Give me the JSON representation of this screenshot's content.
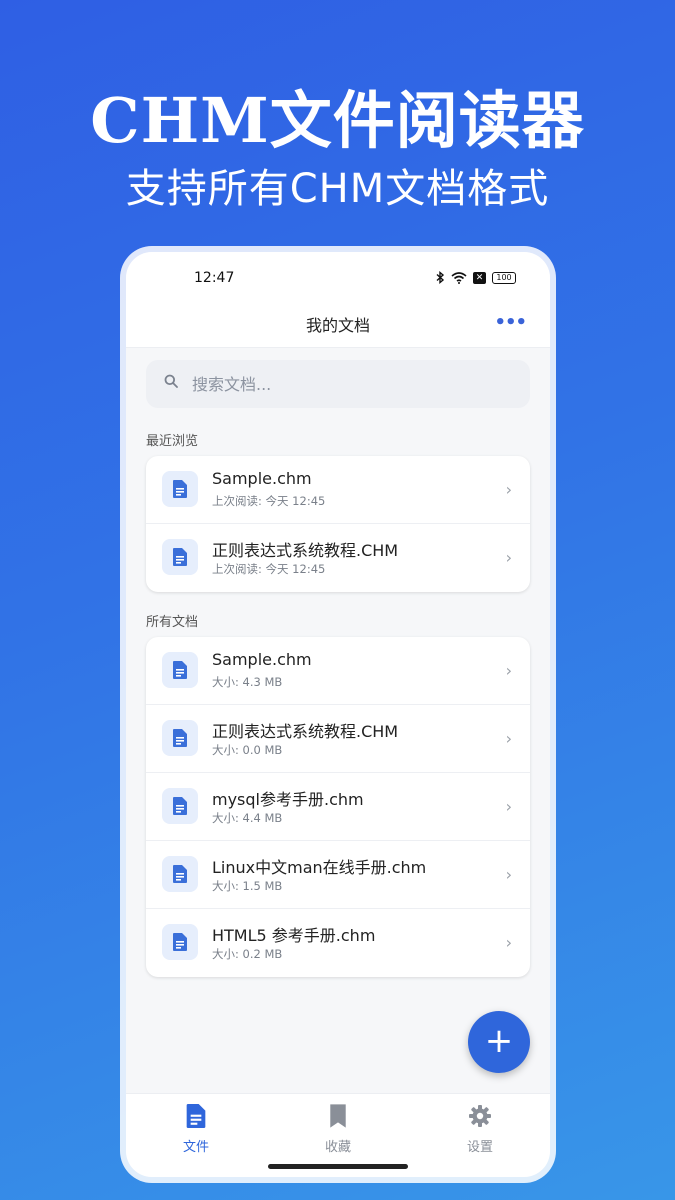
{
  "promo": {
    "title": "CHM文件阅读器",
    "subtitle": "支持所有CHM文档格式"
  },
  "status_bar": {
    "time": "12:47",
    "battery": "100",
    "icons": [
      "bluetooth-icon",
      "wifi-icon",
      "sim-off-icon",
      "battery-icon"
    ]
  },
  "app_bar": {
    "title": "我的文档",
    "more_icon": "more-horizontal-icon"
  },
  "search": {
    "placeholder": "搜索文档..."
  },
  "recent": {
    "label": "最近浏览",
    "items": [
      {
        "name": "Sample.chm",
        "meta": "上次阅读: 今天 12:45"
      },
      {
        "name": "正则表达式系统教程.CHM",
        "meta": "上次阅读: 今天 12:45"
      }
    ]
  },
  "all_docs": {
    "label": "所有文档",
    "items": [
      {
        "name": "Sample.chm",
        "meta": "大小: 4.3 MB"
      },
      {
        "name": "正则表达式系统教程.CHM",
        "meta": "大小: 0.0 MB"
      },
      {
        "name": "mysql参考手册.chm",
        "meta": "大小: 4.4 MB"
      },
      {
        "name": "Linux中文man在线手册.chm",
        "meta": "大小: 1.5 MB"
      },
      {
        "name": "HTML5 参考手册.chm",
        "meta": "大小: 0.2 MB"
      }
    ]
  },
  "fab": {
    "label": "+"
  },
  "bottom_nav": {
    "items": [
      {
        "label": "文件",
        "icon": "document-icon",
        "active": true
      },
      {
        "label": "收藏",
        "icon": "bookmark-icon",
        "active": false
      },
      {
        "label": "设置",
        "icon": "gear-icon",
        "active": false
      }
    ]
  },
  "colors": {
    "accent": "#2f66db",
    "background_top": "#2f5fe4",
    "background_bottom": "#3896e8"
  }
}
